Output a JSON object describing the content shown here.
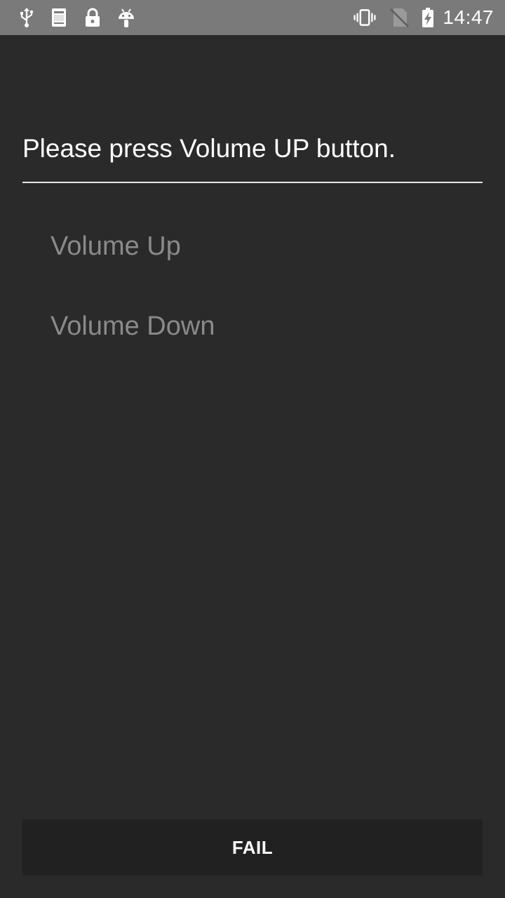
{
  "status_bar": {
    "time": "14:47",
    "left_icons": [
      "usb-icon",
      "log-icon",
      "lock-icon",
      "android-icon"
    ],
    "right_icons": [
      "vibrate-icon",
      "no-sim-icon",
      "battery-charging-icon"
    ]
  },
  "main": {
    "prompt": "Please press Volume UP button.",
    "items": [
      {
        "label": "Volume Up"
      },
      {
        "label": "Volume Down"
      }
    ]
  },
  "footer": {
    "fail_label": "FAIL"
  },
  "colors": {
    "background": "#2a2a2a",
    "status_bar": "#7a7a7a",
    "item_text": "#8a8a8a",
    "button_bg": "#212121"
  }
}
